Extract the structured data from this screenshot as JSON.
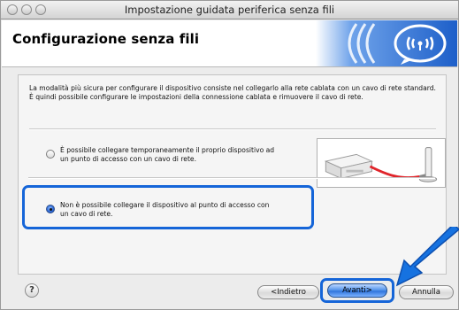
{
  "window": {
    "title": "Impostazione guidata periferica senza fili"
  },
  "header": {
    "title": "Configurazione senza fili",
    "logo_icon": "wireless-signal-icon"
  },
  "intro_text": "La modalità più sicura per configurare il dispositivo consiste nel collegarlo alla rete cablata con un cavo di rete standard. È quindi possibile configurare le impostazioni della connessione cablata e rimuovere il cavo di rete.",
  "options": [
    {
      "label_line1": "È possibile collegare temporaneamente il proprio dispositivo ad",
      "label_line2": "un punto di accesso con un cavo di rete.",
      "selected": false
    },
    {
      "label_line1": "Non è possibile collegare il dispositivo al punto di accesso con",
      "label_line2": "un cavo di rete.",
      "selected": true
    }
  ],
  "footer": {
    "help_label": "?",
    "back_label": "<Indietro",
    "next_label": "Avanti>",
    "cancel_label": "Annulla"
  },
  "colors": {
    "highlight": "#1565d8",
    "default_button": "#2f74dc",
    "cable": "#e0242a"
  }
}
